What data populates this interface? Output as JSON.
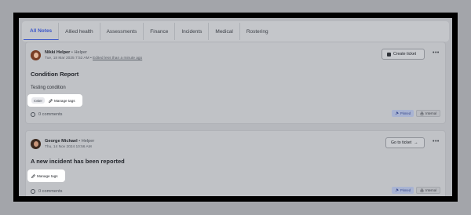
{
  "tabs": [
    {
      "label": "All Notes",
      "active": true
    },
    {
      "label": "Allied health",
      "active": false
    },
    {
      "label": "Assessments",
      "active": false
    },
    {
      "label": "Finance",
      "active": false
    },
    {
      "label": "Incidents",
      "active": false
    },
    {
      "label": "Medical",
      "active": false
    },
    {
      "label": "Rostering",
      "active": false
    }
  ],
  "notes": [
    {
      "author": "Nikki Helper",
      "separator": "•",
      "role": "Helper",
      "timestamp": "Tue, 18 Mar 2025 7:52 AM",
      "meta_separator": "•",
      "edited": "Edited less than a minute ago",
      "title": "Condition Report",
      "body": "Testing condition",
      "tags": [
        "roster"
      ],
      "manage_tags_label": "Manage tags",
      "comments": "0 comments",
      "action_label": "Create ticket",
      "more": "•••",
      "badges": {
        "pinned": "Pinned",
        "internal": "Internal"
      }
    },
    {
      "author": "George Michael",
      "separator": "•",
      "role": "Helper",
      "timestamp": "Thu, 14 Nov 2024 10:56 AM",
      "title": "A new incident has been reported",
      "manage_tags_label": "Manage tags",
      "comments": "0 comments",
      "action_label": "Go to ticket",
      "action_arrow": "→",
      "more": "•••",
      "badges": {
        "pinned": "Pinned",
        "internal": "Internal"
      }
    }
  ],
  "colors": {
    "accent": "#3b57c9",
    "pinned_bg": "#a8b3d2",
    "highlight": "#ffffff"
  }
}
